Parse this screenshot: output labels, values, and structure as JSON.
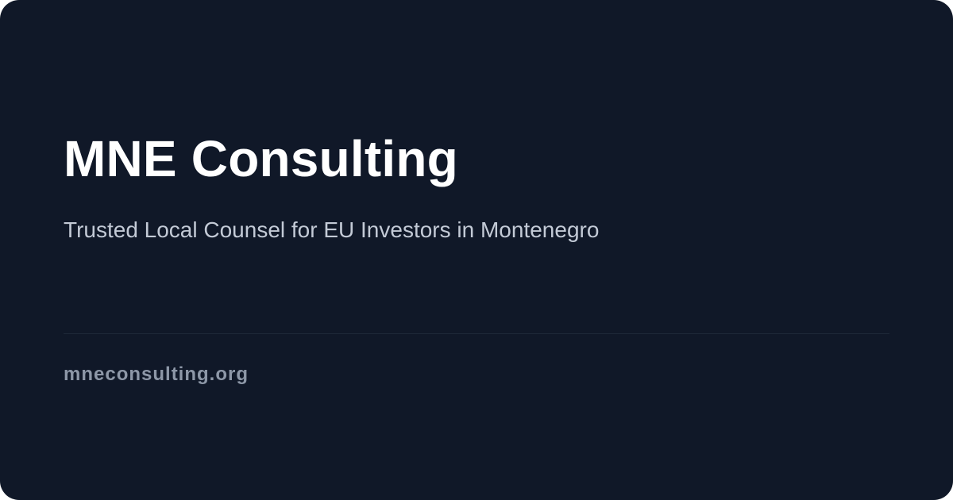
{
  "card": {
    "title": "MNE Consulting",
    "tagline": "Trusted Local Counsel for EU Investors in Montenegro",
    "domain": "mneconsulting.org"
  },
  "colors": {
    "background": "#101828",
    "title": "#ffffff",
    "tagline": "#c3cad6",
    "divider": "#1e2939",
    "domain": "#8d97a7"
  }
}
